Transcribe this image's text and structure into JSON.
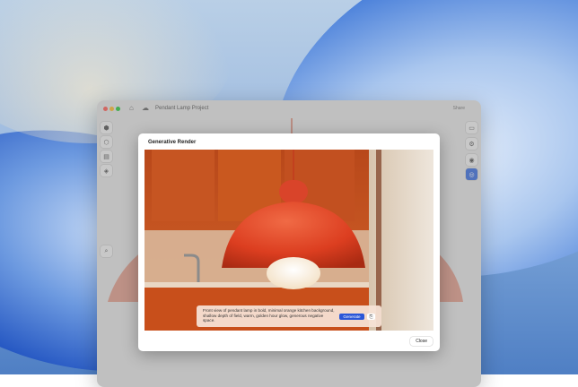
{
  "window": {
    "title": "Pendant Lamp Project",
    "share_label": "Share",
    "left_tools": [
      {
        "name": "cube-icon",
        "glyph": "⬢"
      },
      {
        "name": "sphere-icon",
        "glyph": "⬡"
      },
      {
        "name": "image-icon",
        "glyph": "▤"
      },
      {
        "name": "layers-icon",
        "glyph": "◈"
      }
    ],
    "right_tools": [
      {
        "name": "panel-icon",
        "glyph": "▭"
      },
      {
        "name": "settings-icon",
        "glyph": "⚙"
      },
      {
        "name": "camera-icon",
        "glyph": "◉"
      },
      {
        "name": "render-camera-icon",
        "glyph": "◎",
        "active": true
      }
    ],
    "search_glyph": "⌕"
  },
  "modal": {
    "title": "Generative Render",
    "prompt": "Front view of pendant lamp in bold, minimal orange kitchen background, shallow depth of field, warm, golden hour glow, generous negative space.",
    "generate_label": "Generate",
    "close_label": "Close",
    "copy_glyph": "⎘"
  },
  "colors": {
    "accent": "#2a56d8",
    "lamp": "#e0472a",
    "kitchen": "#c8541f"
  }
}
